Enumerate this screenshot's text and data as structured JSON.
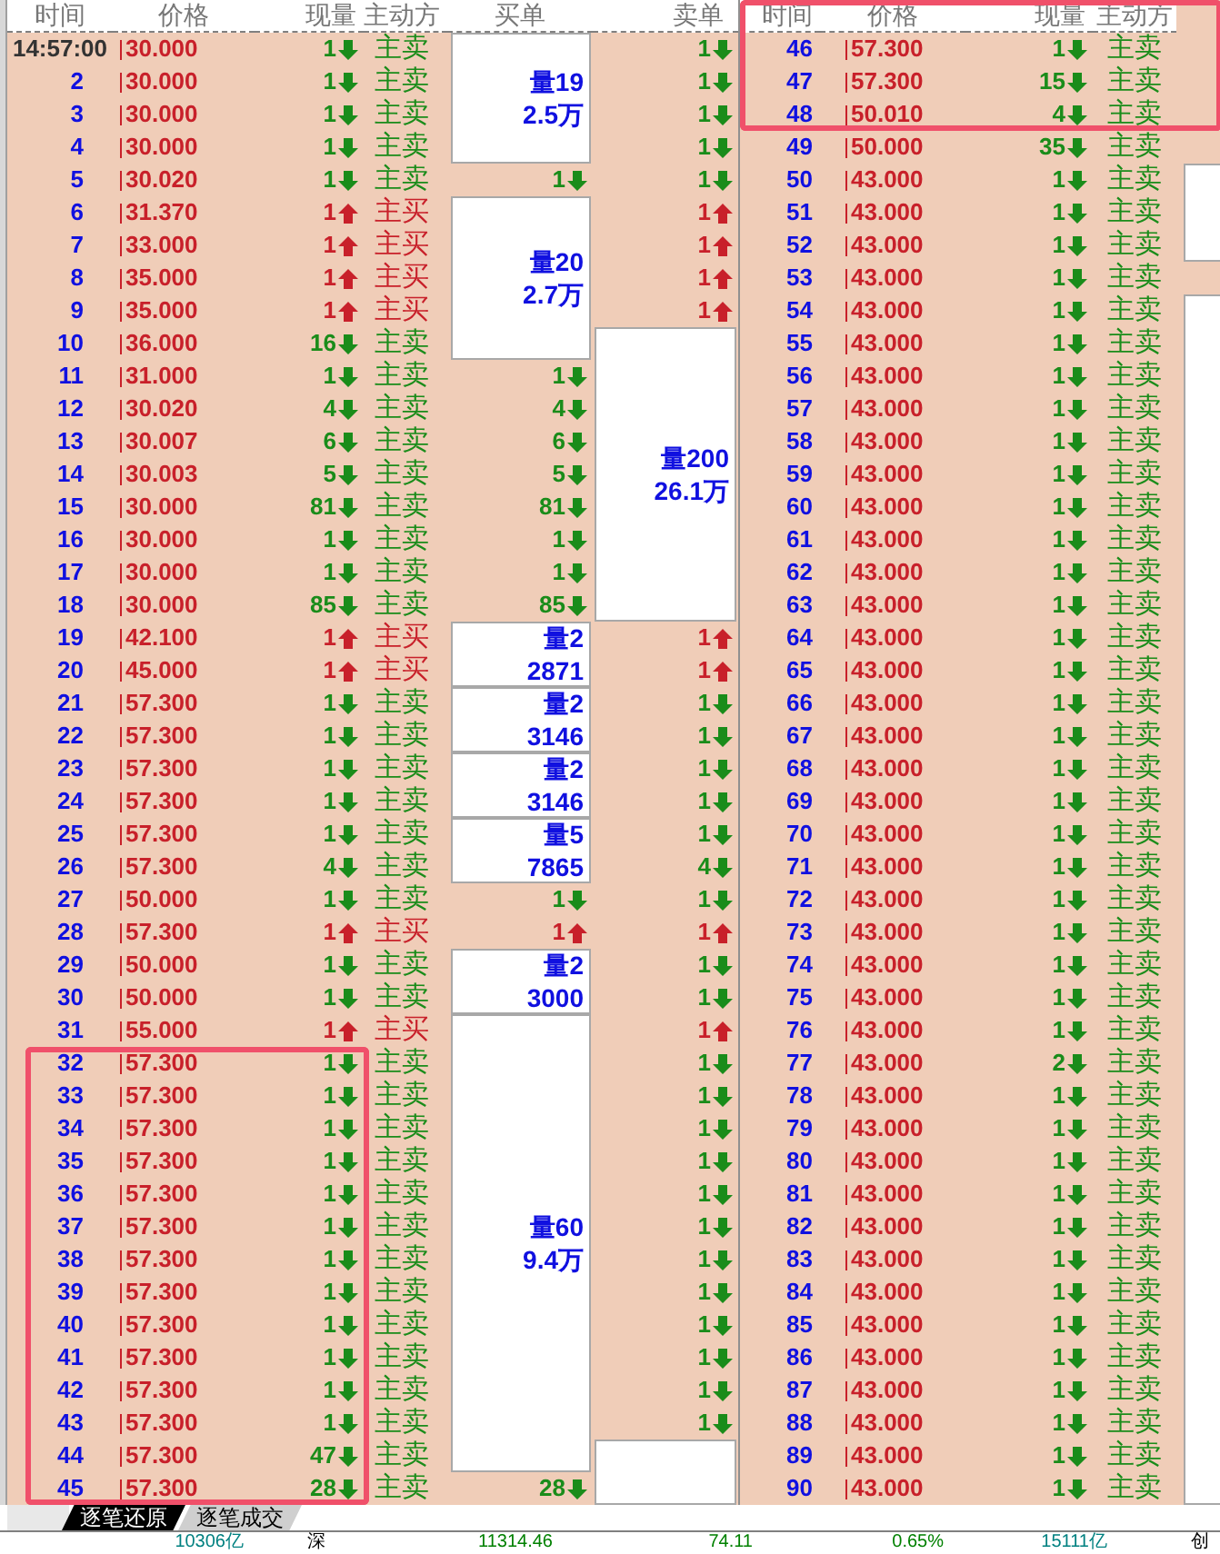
{
  "left_table": {
    "columns": [
      "时间",
      "价格",
      "现量",
      "主动方",
      "买单",
      "卖单"
    ],
    "rows": [
      {
        "time": "14:57:00",
        "price": "30.000",
        "qty": "1",
        "rising": false,
        "side": "主卖",
        "active_buy": false,
        "buy": {
          "kind": "box",
          "lines": [
            "量19",
            "2.5万"
          ]
        },
        "sell": {
          "kind": "trade",
          "qty": "1",
          "rising": false
        },
        "highlighted": false
      },
      {
        "seq": "2",
        "price": "30.000",
        "qty": "1",
        "rising": false,
        "side": "主卖",
        "active_buy": false,
        "buy": {
          "kind": "box_continued"
        },
        "sell": {
          "kind": "trade",
          "qty": "1",
          "rising": false
        },
        "highlighted": false
      },
      {
        "seq": "3",
        "price": "30.000",
        "qty": "1",
        "rising": false,
        "side": "主卖",
        "active_buy": false,
        "buy": {
          "kind": "box_continued"
        },
        "sell": {
          "kind": "trade",
          "qty": "1",
          "rising": false
        },
        "highlighted": false
      },
      {
        "seq": "4",
        "price": "30.000",
        "qty": "1",
        "rising": false,
        "side": "主卖",
        "active_buy": false,
        "buy": {
          "kind": "box_continued"
        },
        "sell": {
          "kind": "trade",
          "qty": "1",
          "rising": false
        },
        "highlighted": false
      },
      {
        "seq": "5",
        "price": "30.020",
        "qty": "1",
        "rising": false,
        "side": "主卖",
        "active_buy": false,
        "buy": {
          "kind": "trade",
          "qty": "1",
          "rising": false
        },
        "sell": {
          "kind": "trade",
          "qty": "1",
          "rising": false
        },
        "highlighted": false
      },
      {
        "seq": "6",
        "price": "31.370",
        "qty": "1",
        "rising": true,
        "side": "主买",
        "active_buy": true,
        "buy": {
          "kind": "box",
          "lines": [
            "量20",
            "2.7万"
          ]
        },
        "sell": {
          "kind": "trade",
          "qty": "1",
          "rising": true
        },
        "highlighted": false
      },
      {
        "seq": "7",
        "price": "33.000",
        "qty": "1",
        "rising": true,
        "side": "主买",
        "active_buy": true,
        "buy": {
          "kind": "box_continued"
        },
        "sell": {
          "kind": "trade",
          "qty": "1",
          "rising": true
        },
        "highlighted": false
      },
      {
        "seq": "8",
        "price": "35.000",
        "qty": "1",
        "rising": true,
        "side": "主买",
        "active_buy": true,
        "buy": {
          "kind": "box_continued"
        },
        "sell": {
          "kind": "trade",
          "qty": "1",
          "rising": true
        },
        "highlighted": false
      },
      {
        "seq": "9",
        "price": "35.000",
        "qty": "1",
        "rising": true,
        "side": "主买",
        "active_buy": true,
        "buy": {
          "kind": "box_continued"
        },
        "sell": {
          "kind": "trade",
          "qty": "1",
          "rising": true
        },
        "highlighted": false
      },
      {
        "seq": "10",
        "price": "36.000",
        "qty": "16",
        "rising": false,
        "side": "主卖",
        "active_buy": false,
        "buy": {
          "kind": "box_continued"
        },
        "sell": {
          "kind": "box",
          "lines": [
            "量200",
            "26.1万"
          ]
        },
        "highlighted": false
      },
      {
        "seq": "11",
        "price": "31.000",
        "qty": "1",
        "rising": false,
        "side": "主卖",
        "active_buy": false,
        "buy": {
          "kind": "trade",
          "qty": "1",
          "rising": false
        },
        "sell": {
          "kind": "box_continued"
        },
        "highlighted": false
      },
      {
        "seq": "12",
        "price": "30.020",
        "qty": "4",
        "rising": false,
        "side": "主卖",
        "active_buy": false,
        "buy": {
          "kind": "trade",
          "qty": "4",
          "rising": false
        },
        "sell": {
          "kind": "box_continued"
        },
        "highlighted": false
      },
      {
        "seq": "13",
        "price": "30.007",
        "qty": "6",
        "rising": false,
        "side": "主卖",
        "active_buy": false,
        "buy": {
          "kind": "trade",
          "qty": "6",
          "rising": false
        },
        "sell": {
          "kind": "box_continued"
        },
        "highlighted": false
      },
      {
        "seq": "14",
        "price": "30.003",
        "qty": "5",
        "rising": false,
        "side": "主卖",
        "active_buy": false,
        "buy": {
          "kind": "trade",
          "qty": "5",
          "rising": false
        },
        "sell": {
          "kind": "box_continued"
        },
        "highlighted": false
      },
      {
        "seq": "15",
        "price": "30.000",
        "qty": "81",
        "rising": false,
        "side": "主卖",
        "active_buy": false,
        "buy": {
          "kind": "trade",
          "qty": "81",
          "rising": false
        },
        "sell": {
          "kind": "box_continued"
        },
        "highlighted": false
      },
      {
        "seq": "16",
        "price": "30.000",
        "qty": "1",
        "rising": false,
        "side": "主卖",
        "active_buy": false,
        "buy": {
          "kind": "trade",
          "qty": "1",
          "rising": false
        },
        "sell": {
          "kind": "box_continued"
        },
        "highlighted": false
      },
      {
        "seq": "17",
        "price": "30.000",
        "qty": "1",
        "rising": false,
        "side": "主卖",
        "active_buy": false,
        "buy": {
          "kind": "trade",
          "qty": "1",
          "rising": false
        },
        "sell": {
          "kind": "box_continued"
        },
        "highlighted": false
      },
      {
        "seq": "18",
        "price": "30.000",
        "qty": "85",
        "rising": false,
        "side": "主卖",
        "active_buy": false,
        "buy": {
          "kind": "trade",
          "qty": "85",
          "rising": false
        },
        "sell": {
          "kind": "box_continued"
        },
        "highlighted": false
      },
      {
        "seq": "19",
        "price": "42.100",
        "qty": "1",
        "rising": true,
        "side": "主买",
        "active_buy": true,
        "buy": {
          "kind": "box",
          "lines": [
            "量2",
            "2871"
          ]
        },
        "sell": {
          "kind": "trade",
          "qty": "1",
          "rising": true
        },
        "highlighted": false
      },
      {
        "seq": "20",
        "price": "45.000",
        "qty": "1",
        "rising": true,
        "side": "主买",
        "active_buy": true,
        "buy": {
          "kind": "box_continued"
        },
        "sell": {
          "kind": "trade",
          "qty": "1",
          "rising": true
        },
        "highlighted": false
      },
      {
        "seq": "21",
        "price": "57.300",
        "qty": "1",
        "rising": false,
        "side": "主卖",
        "active_buy": false,
        "buy": {
          "kind": "box",
          "lines": [
            "量2",
            "3146"
          ]
        },
        "sell": {
          "kind": "trade",
          "qty": "1",
          "rising": false
        },
        "highlighted": false
      },
      {
        "seq": "22",
        "price": "57.300",
        "qty": "1",
        "rising": false,
        "side": "主卖",
        "active_buy": false,
        "buy": {
          "kind": "box_continued"
        },
        "sell": {
          "kind": "trade",
          "qty": "1",
          "rising": false
        },
        "highlighted": false
      },
      {
        "seq": "23",
        "price": "57.300",
        "qty": "1",
        "rising": false,
        "side": "主卖",
        "active_buy": false,
        "buy": {
          "kind": "box",
          "lines": [
            "量2",
            "3146"
          ]
        },
        "sell": {
          "kind": "trade",
          "qty": "1",
          "rising": false
        },
        "highlighted": false
      },
      {
        "seq": "24",
        "price": "57.300",
        "qty": "1",
        "rising": false,
        "side": "主卖",
        "active_buy": false,
        "buy": {
          "kind": "box_continued"
        },
        "sell": {
          "kind": "trade",
          "qty": "1",
          "rising": false
        },
        "highlighted": false
      },
      {
        "seq": "25",
        "price": "57.300",
        "qty": "1",
        "rising": false,
        "side": "主卖",
        "active_buy": false,
        "buy": {
          "kind": "box",
          "lines": [
            "量5",
            "7865"
          ]
        },
        "sell": {
          "kind": "trade",
          "qty": "1",
          "rising": false
        },
        "highlighted": false
      },
      {
        "seq": "26",
        "price": "57.300",
        "qty": "4",
        "rising": false,
        "side": "主卖",
        "active_buy": false,
        "buy": {
          "kind": "box_continued"
        },
        "sell": {
          "kind": "trade",
          "qty": "4",
          "rising": false
        },
        "highlighted": false
      },
      {
        "seq": "27",
        "price": "50.000",
        "qty": "1",
        "rising": false,
        "side": "主卖",
        "active_buy": false,
        "buy": {
          "kind": "trade",
          "qty": "1",
          "rising": false
        },
        "sell": {
          "kind": "trade",
          "qty": "1",
          "rising": false
        },
        "highlighted": false
      },
      {
        "seq": "28",
        "price": "57.300",
        "qty": "1",
        "rising": true,
        "side": "主买",
        "active_buy": true,
        "buy": {
          "kind": "trade",
          "qty": "1",
          "rising": true
        },
        "sell": {
          "kind": "trade",
          "qty": "1",
          "rising": true
        },
        "highlighted": false
      },
      {
        "seq": "29",
        "price": "50.000",
        "qty": "1",
        "rising": false,
        "side": "主卖",
        "active_buy": false,
        "buy": {
          "kind": "box",
          "lines": [
            "量2",
            "3000"
          ]
        },
        "sell": {
          "kind": "trade",
          "qty": "1",
          "rising": false
        },
        "highlighted": false
      },
      {
        "seq": "30",
        "price": "50.000",
        "qty": "1",
        "rising": false,
        "side": "主卖",
        "active_buy": false,
        "buy": {
          "kind": "box_continued"
        },
        "sell": {
          "kind": "trade",
          "qty": "1",
          "rising": false
        },
        "highlighted": false
      },
      {
        "seq": "31",
        "price": "55.000",
        "qty": "1",
        "rising": true,
        "side": "主买",
        "active_buy": true,
        "buy": {
          "kind": "box",
          "lines": [
            "量60",
            "9.4万"
          ]
        },
        "sell": {
          "kind": "trade",
          "qty": "1",
          "rising": true
        },
        "highlighted": false
      },
      {
        "seq": "32",
        "price": "57.300",
        "qty": "1",
        "rising": false,
        "side": "主卖",
        "active_buy": false,
        "buy": {
          "kind": "box_continued"
        },
        "sell": {
          "kind": "trade",
          "qty": "1",
          "rising": false
        },
        "highlighted": true
      },
      {
        "seq": "33",
        "price": "57.300",
        "qty": "1",
        "rising": false,
        "side": "主卖",
        "active_buy": false,
        "buy": {
          "kind": "box_continued"
        },
        "sell": {
          "kind": "trade",
          "qty": "1",
          "rising": false
        },
        "highlighted": true
      },
      {
        "seq": "34",
        "price": "57.300",
        "qty": "1",
        "rising": false,
        "side": "主卖",
        "active_buy": false,
        "buy": {
          "kind": "box_continued"
        },
        "sell": {
          "kind": "trade",
          "qty": "1",
          "rising": false
        },
        "highlighted": true
      },
      {
        "seq": "35",
        "price": "57.300",
        "qty": "1",
        "rising": false,
        "side": "主卖",
        "active_buy": false,
        "buy": {
          "kind": "box_continued"
        },
        "sell": {
          "kind": "trade",
          "qty": "1",
          "rising": false
        },
        "highlighted": true
      },
      {
        "seq": "36",
        "price": "57.300",
        "qty": "1",
        "rising": false,
        "side": "主卖",
        "active_buy": false,
        "buy": {
          "kind": "box_continued"
        },
        "sell": {
          "kind": "trade",
          "qty": "1",
          "rising": false
        },
        "highlighted": true
      },
      {
        "seq": "37",
        "price": "57.300",
        "qty": "1",
        "rising": false,
        "side": "主卖",
        "active_buy": false,
        "buy": {
          "kind": "box_continued"
        },
        "sell": {
          "kind": "trade",
          "qty": "1",
          "rising": false
        },
        "highlighted": true
      },
      {
        "seq": "38",
        "price": "57.300",
        "qty": "1",
        "rising": false,
        "side": "主卖",
        "active_buy": false,
        "buy": {
          "kind": "box_continued"
        },
        "sell": {
          "kind": "trade",
          "qty": "1",
          "rising": false
        },
        "highlighted": true
      },
      {
        "seq": "39",
        "price": "57.300",
        "qty": "1",
        "rising": false,
        "side": "主卖",
        "active_buy": false,
        "buy": {
          "kind": "box_continued"
        },
        "sell": {
          "kind": "trade",
          "qty": "1",
          "rising": false
        },
        "highlighted": true
      },
      {
        "seq": "40",
        "price": "57.300",
        "qty": "1",
        "rising": false,
        "side": "主卖",
        "active_buy": false,
        "buy": {
          "kind": "box_continued"
        },
        "sell": {
          "kind": "trade",
          "qty": "1",
          "rising": false
        },
        "highlighted": true
      },
      {
        "seq": "41",
        "price": "57.300",
        "qty": "1",
        "rising": false,
        "side": "主卖",
        "active_buy": false,
        "buy": {
          "kind": "box_continued"
        },
        "sell": {
          "kind": "trade",
          "qty": "1",
          "rising": false
        },
        "highlighted": true
      },
      {
        "seq": "42",
        "price": "57.300",
        "qty": "1",
        "rising": false,
        "side": "主卖",
        "active_buy": false,
        "buy": {
          "kind": "box_continued"
        },
        "sell": {
          "kind": "trade",
          "qty": "1",
          "rising": false
        },
        "highlighted": true
      },
      {
        "seq": "43",
        "price": "57.300",
        "qty": "1",
        "rising": false,
        "side": "主卖",
        "active_buy": false,
        "buy": {
          "kind": "box_continued"
        },
        "sell": {
          "kind": "trade",
          "qty": "1",
          "rising": false
        },
        "highlighted": true
      },
      {
        "seq": "44",
        "price": "57.300",
        "qty": "47",
        "rising": false,
        "side": "主卖",
        "active_buy": false,
        "buy": {
          "kind": "box_continued"
        },
        "sell": {
          "kind": "box"
        },
        "highlighted": true
      },
      {
        "seq": "45",
        "price": "57.300",
        "qty": "28",
        "rising": false,
        "side": "主卖",
        "active_buy": false,
        "buy": {
          "kind": "trade",
          "qty": "28",
          "rising": false
        },
        "sell": {
          "kind": "box_continued"
        },
        "highlighted": true
      }
    ]
  },
  "right_table": {
    "columns": [
      "时间",
      "价格",
      "现量",
      "主动方"
    ],
    "header_highlighted": true,
    "rows": [
      {
        "seq": "46",
        "price": "57.300",
        "qty": "1",
        "rising": false,
        "side": "主卖",
        "active_buy": false,
        "column_5": {
          "kind": "empty"
        },
        "highlighted": true
      },
      {
        "seq": "47",
        "price": "57.300",
        "qty": "15",
        "rising": false,
        "side": "主卖",
        "active_buy": false,
        "column_5": {
          "kind": "empty"
        },
        "highlighted": true
      },
      {
        "seq": "48",
        "price": "50.010",
        "qty": "4",
        "rising": false,
        "side": "主卖",
        "active_buy": false,
        "column_5": {
          "kind": "empty"
        },
        "highlighted": true
      },
      {
        "seq": "49",
        "price": "50.000",
        "qty": "35",
        "rising": false,
        "side": "主卖",
        "active_buy": false,
        "column_5": {
          "kind": "empty"
        },
        "highlighted": false
      },
      {
        "seq": "50",
        "price": "43.000",
        "qty": "1",
        "rising": false,
        "side": "主卖",
        "active_buy": false,
        "column_5": {
          "kind": "box"
        },
        "highlighted": false
      },
      {
        "seq": "51",
        "price": "43.000",
        "qty": "1",
        "rising": false,
        "side": "主卖",
        "active_buy": false,
        "column_5": {
          "kind": "box_continued"
        },
        "highlighted": false
      },
      {
        "seq": "52",
        "price": "43.000",
        "qty": "1",
        "rising": false,
        "side": "主卖",
        "active_buy": false,
        "column_5": {
          "kind": "box_continued"
        },
        "highlighted": false
      },
      {
        "seq": "53",
        "price": "43.000",
        "qty": "1",
        "rising": false,
        "side": "主卖",
        "active_buy": false,
        "column_5": {
          "kind": "empty"
        },
        "highlighted": false
      },
      {
        "seq": "54",
        "price": "43.000",
        "qty": "1",
        "rising": false,
        "side": "主卖",
        "active_buy": false,
        "column_5": {
          "kind": "box"
        },
        "highlighted": false
      },
      {
        "seq": "55",
        "price": "43.000",
        "qty": "1",
        "rising": false,
        "side": "主卖",
        "active_buy": false,
        "column_5": {
          "kind": "box_continued"
        },
        "highlighted": false
      },
      {
        "seq": "56",
        "price": "43.000",
        "qty": "1",
        "rising": false,
        "side": "主卖",
        "active_buy": false,
        "column_5": {
          "kind": "box_continued"
        },
        "highlighted": false
      },
      {
        "seq": "57",
        "price": "43.000",
        "qty": "1",
        "rising": false,
        "side": "主卖",
        "active_buy": false,
        "column_5": {
          "kind": "box_continued"
        },
        "highlighted": false
      },
      {
        "seq": "58",
        "price": "43.000",
        "qty": "1",
        "rising": false,
        "side": "主卖",
        "active_buy": false,
        "column_5": {
          "kind": "box_continued"
        },
        "highlighted": false
      },
      {
        "seq": "59",
        "price": "43.000",
        "qty": "1",
        "rising": false,
        "side": "主卖",
        "active_buy": false,
        "column_5": {
          "kind": "box_continued"
        },
        "highlighted": false
      },
      {
        "seq": "60",
        "price": "43.000",
        "qty": "1",
        "rising": false,
        "side": "主卖",
        "active_buy": false,
        "column_5": {
          "kind": "box_continued"
        },
        "highlighted": false
      },
      {
        "seq": "61",
        "price": "43.000",
        "qty": "1",
        "rising": false,
        "side": "主卖",
        "active_buy": false,
        "column_5": {
          "kind": "box_continued"
        },
        "highlighted": false
      },
      {
        "seq": "62",
        "price": "43.000",
        "qty": "1",
        "rising": false,
        "side": "主卖",
        "active_buy": false,
        "column_5": {
          "kind": "box_continued"
        },
        "highlighted": false
      },
      {
        "seq": "63",
        "price": "43.000",
        "qty": "1",
        "rising": false,
        "side": "主卖",
        "active_buy": false,
        "column_5": {
          "kind": "box_continued"
        },
        "highlighted": false
      },
      {
        "seq": "64",
        "price": "43.000",
        "qty": "1",
        "rising": false,
        "side": "主卖",
        "active_buy": false,
        "column_5": {
          "kind": "box_continued"
        },
        "highlighted": false
      },
      {
        "seq": "65",
        "price": "43.000",
        "qty": "1",
        "rising": false,
        "side": "主卖",
        "active_buy": false,
        "column_5": {
          "kind": "box_continued"
        },
        "highlighted": false
      },
      {
        "seq": "66",
        "price": "43.000",
        "qty": "1",
        "rising": false,
        "side": "主卖",
        "active_buy": false,
        "column_5": {
          "kind": "box_continued"
        },
        "highlighted": false
      },
      {
        "seq": "67",
        "price": "43.000",
        "qty": "1",
        "rising": false,
        "side": "主卖",
        "active_buy": false,
        "column_5": {
          "kind": "box_continued"
        },
        "highlighted": false
      },
      {
        "seq": "68",
        "price": "43.000",
        "qty": "1",
        "rising": false,
        "side": "主卖",
        "active_buy": false,
        "column_5": {
          "kind": "box_continued"
        },
        "highlighted": false
      },
      {
        "seq": "69",
        "price": "43.000",
        "qty": "1",
        "rising": false,
        "side": "主卖",
        "active_buy": false,
        "column_5": {
          "kind": "box_continued"
        },
        "highlighted": false
      },
      {
        "seq": "70",
        "price": "43.000",
        "qty": "1",
        "rising": false,
        "side": "主卖",
        "active_buy": false,
        "column_5": {
          "kind": "box_continued"
        },
        "highlighted": false
      },
      {
        "seq": "71",
        "price": "43.000",
        "qty": "1",
        "rising": false,
        "side": "主卖",
        "active_buy": false,
        "column_5": {
          "kind": "box_continued"
        },
        "highlighted": false
      },
      {
        "seq": "72",
        "price": "43.000",
        "qty": "1",
        "rising": false,
        "side": "主卖",
        "active_buy": false,
        "column_5": {
          "kind": "box_continued"
        },
        "highlighted": false
      },
      {
        "seq": "73",
        "price": "43.000",
        "qty": "1",
        "rising": false,
        "side": "主卖",
        "active_buy": false,
        "column_5": {
          "kind": "box_continued"
        },
        "highlighted": false
      },
      {
        "seq": "74",
        "price": "43.000",
        "qty": "1",
        "rising": false,
        "side": "主卖",
        "active_buy": false,
        "column_5": {
          "kind": "box_continued"
        },
        "highlighted": false
      },
      {
        "seq": "75",
        "price": "43.000",
        "qty": "1",
        "rising": false,
        "side": "主卖",
        "active_buy": false,
        "column_5": {
          "kind": "box_continued"
        },
        "highlighted": false
      },
      {
        "seq": "76",
        "price": "43.000",
        "qty": "1",
        "rising": false,
        "side": "主卖",
        "active_buy": false,
        "column_5": {
          "kind": "box_continued"
        },
        "highlighted": false
      },
      {
        "seq": "77",
        "price": "43.000",
        "qty": "2",
        "rising": false,
        "side": "主卖",
        "active_buy": false,
        "column_5": {
          "kind": "box_continued"
        },
        "highlighted": false
      },
      {
        "seq": "78",
        "price": "43.000",
        "qty": "1",
        "rising": false,
        "side": "主卖",
        "active_buy": false,
        "column_5": {
          "kind": "box_continued"
        },
        "highlighted": false
      },
      {
        "seq": "79",
        "price": "43.000",
        "qty": "1",
        "rising": false,
        "side": "主卖",
        "active_buy": false,
        "column_5": {
          "kind": "box_continued"
        },
        "highlighted": false
      },
      {
        "seq": "80",
        "price": "43.000",
        "qty": "1",
        "rising": false,
        "side": "主卖",
        "active_buy": false,
        "column_5": {
          "kind": "box_continued"
        },
        "highlighted": false
      },
      {
        "seq": "81",
        "price": "43.000",
        "qty": "1",
        "rising": false,
        "side": "主卖",
        "active_buy": false,
        "column_5": {
          "kind": "box_continued"
        },
        "highlighted": false
      },
      {
        "seq": "82",
        "price": "43.000",
        "qty": "1",
        "rising": false,
        "side": "主卖",
        "active_buy": false,
        "column_5": {
          "kind": "box_continued"
        },
        "highlighted": false
      },
      {
        "seq": "83",
        "price": "43.000",
        "qty": "1",
        "rising": false,
        "side": "主卖",
        "active_buy": false,
        "column_5": {
          "kind": "box_continued"
        },
        "highlighted": false
      },
      {
        "seq": "84",
        "price": "43.000",
        "qty": "1",
        "rising": false,
        "side": "主卖",
        "active_buy": false,
        "column_5": {
          "kind": "box_continued"
        },
        "highlighted": false
      },
      {
        "seq": "85",
        "price": "43.000",
        "qty": "1",
        "rising": false,
        "side": "主卖",
        "active_buy": false,
        "column_5": {
          "kind": "box_continued"
        },
        "highlighted": false
      },
      {
        "seq": "86",
        "price": "43.000",
        "qty": "1",
        "rising": false,
        "side": "主卖",
        "active_buy": false,
        "column_5": {
          "kind": "box_continued"
        },
        "highlighted": false
      },
      {
        "seq": "87",
        "price": "43.000",
        "qty": "1",
        "rising": false,
        "side": "主卖",
        "active_buy": false,
        "column_5": {
          "kind": "box_continued"
        },
        "highlighted": false
      },
      {
        "seq": "88",
        "price": "43.000",
        "qty": "1",
        "rising": false,
        "side": "主卖",
        "active_buy": false,
        "column_5": {
          "kind": "box_continued"
        },
        "highlighted": false
      },
      {
        "seq": "89",
        "price": "43.000",
        "qty": "1",
        "rising": false,
        "side": "主卖",
        "active_buy": false,
        "column_5": {
          "kind": "box_continued"
        },
        "highlighted": false
      },
      {
        "seq": "90",
        "price": "43.000",
        "qty": "1",
        "rising": false,
        "side": "主卖",
        "active_buy": false,
        "column_5": {
          "kind": "box_continued"
        },
        "highlighted": false
      }
    ]
  },
  "tabs": [
    {
      "label": "逐笔还原",
      "selected": true
    },
    {
      "label": "逐笔成交",
      "selected": false
    }
  ],
  "status_bar": [
    {
      "text": "10306亿",
      "color": "#008080"
    },
    {
      "text": "深",
      "color": "#000000"
    },
    {
      "text": "11314.46",
      "color": "#008000"
    },
    {
      "text": "74.11",
      "color": "#008000"
    },
    {
      "text": "0.65%",
      "color": "#008000"
    },
    {
      "text": "15111亿",
      "color": "#008080"
    },
    {
      "text": "创",
      "color": "#000000"
    }
  ]
}
